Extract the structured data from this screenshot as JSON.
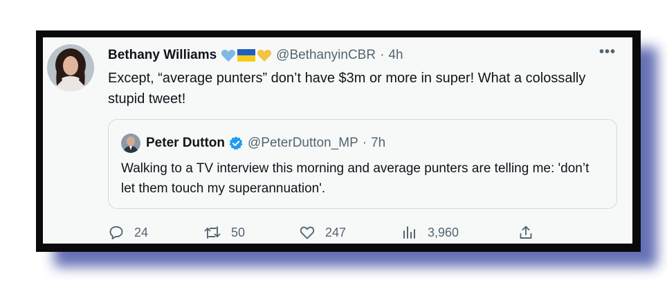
{
  "tweet": {
    "author_name": "Bethany Williams",
    "handle": "@BethanyinCBR",
    "time_sep": "·",
    "time": "4h",
    "text": "Except, “average punters” don’t have $3m or more in super! What a colossally stupid tweet!",
    "emojis": [
      "blue-heart",
      "ukraine-flag",
      "yellow-heart"
    ]
  },
  "quote": {
    "author_name": "Peter Dutton",
    "handle": "@PeterDutton_MP",
    "time_sep": "·",
    "time": "7h",
    "text": "Walking to a TV interview this morning and average punters are telling me: 'don’t let them touch my superannuation'."
  },
  "actions": {
    "replies": "24",
    "retweets": "50",
    "likes": "247",
    "views": "3,960"
  },
  "colors": {
    "text_primary": "#0f1419",
    "text_secondary": "#536471",
    "verified_blue": "#1d9bf0",
    "border": "#cfd9de",
    "frame": "#0a0a0a",
    "shadow": "#5561ad"
  }
}
